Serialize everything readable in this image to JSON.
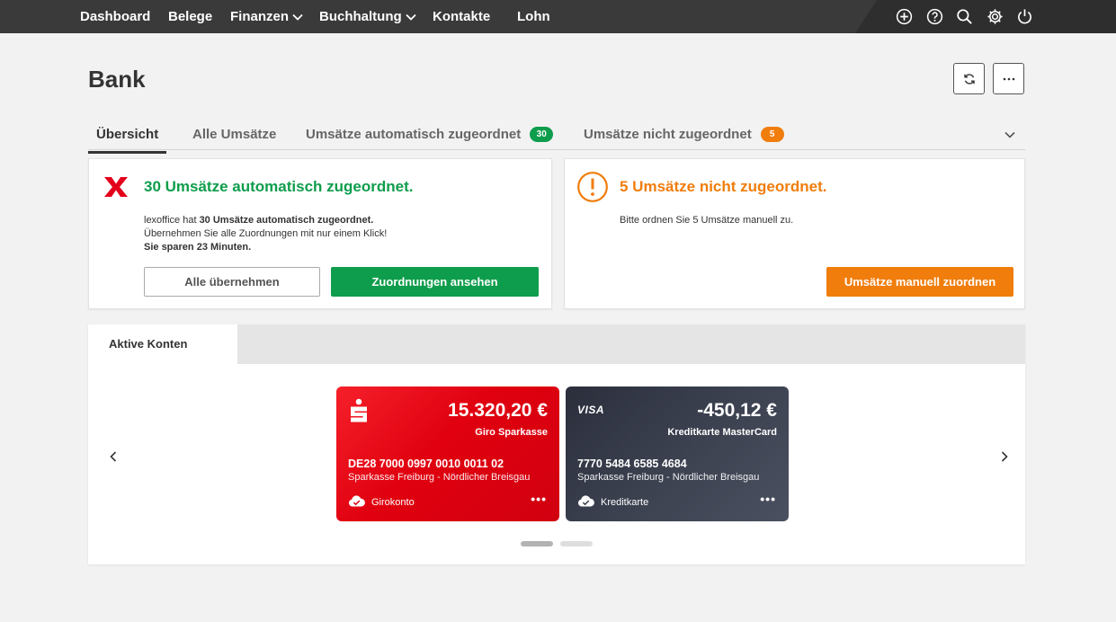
{
  "colors": {
    "nav_bg": "#3a3a3a",
    "green": "#0e9d4c",
    "orange": "#f07d0c",
    "brand_red": "#e4001b",
    "sparkasse_red": "#e0000f",
    "visa_dark": "#323644"
  },
  "nav": {
    "items": [
      {
        "label": "Dashboard"
      },
      {
        "label": "Belege"
      },
      {
        "label": "Finanzen",
        "dropdown": true
      },
      {
        "label": "Buchhaltung",
        "dropdown": true
      },
      {
        "label": "Kontakte"
      },
      {
        "label": "Lohn"
      }
    ],
    "icons": [
      "plus-circle-icon",
      "help-icon",
      "search-icon",
      "gear-icon",
      "power-icon"
    ]
  },
  "page": {
    "title": "Bank",
    "actions": [
      "refresh-icon",
      "more-icon"
    ]
  },
  "tabs": [
    {
      "label": "Übersicht",
      "active": true
    },
    {
      "label": "Alle Umsätze"
    },
    {
      "label": "Umsätze automatisch zugeordnet",
      "badge": "30",
      "badge_color": "#0e9d4c"
    },
    {
      "label": "Umsätze nicht zugeordnet",
      "badge": "5",
      "badge_color": "#f07d0c"
    }
  ],
  "auto_card": {
    "title": "30 Umsätze automatisch zugeordnet.",
    "line1_prefix": "lexoffice hat ",
    "line1_bold": "30 Umsätze automatisch zugeordnet.",
    "line2": "Übernehmen Sie alle Zuordnungen mit nur einem Klick!",
    "line3": "Sie sparen 23 Minuten.",
    "btn_secondary": "Alle übernehmen",
    "btn_primary": "Zuordnungen ansehen"
  },
  "manual_card": {
    "title": "5 Umsätze nicht zugeordnet.",
    "text": "Bitte ordnen Sie 5 Umsätze manuell zu.",
    "btn_primary": "Umsätze manuell zuordnen"
  },
  "accounts": {
    "tab_label": "Aktive Konten",
    "cards": [
      {
        "amount": "15.320,20 €",
        "name": "Giro Sparkasse",
        "number": "DE28 7000 0997 0010 0011 02",
        "bank": "Sparkasse Freiburg - Nördlicher Breisgau",
        "type": "Girokonto",
        "logo": "sparkasse-logo-icon"
      },
      {
        "amount": "-450,12 €",
        "name": "Kreditkarte MasterCard",
        "number": "7770 5484 6585 4684",
        "bank": "Sparkasse Freiburg - Nördlicher Breisgau",
        "type": "Kreditkarte",
        "logo_text": "VISA"
      }
    ],
    "pagination": {
      "pages": 2,
      "current": 1
    }
  }
}
